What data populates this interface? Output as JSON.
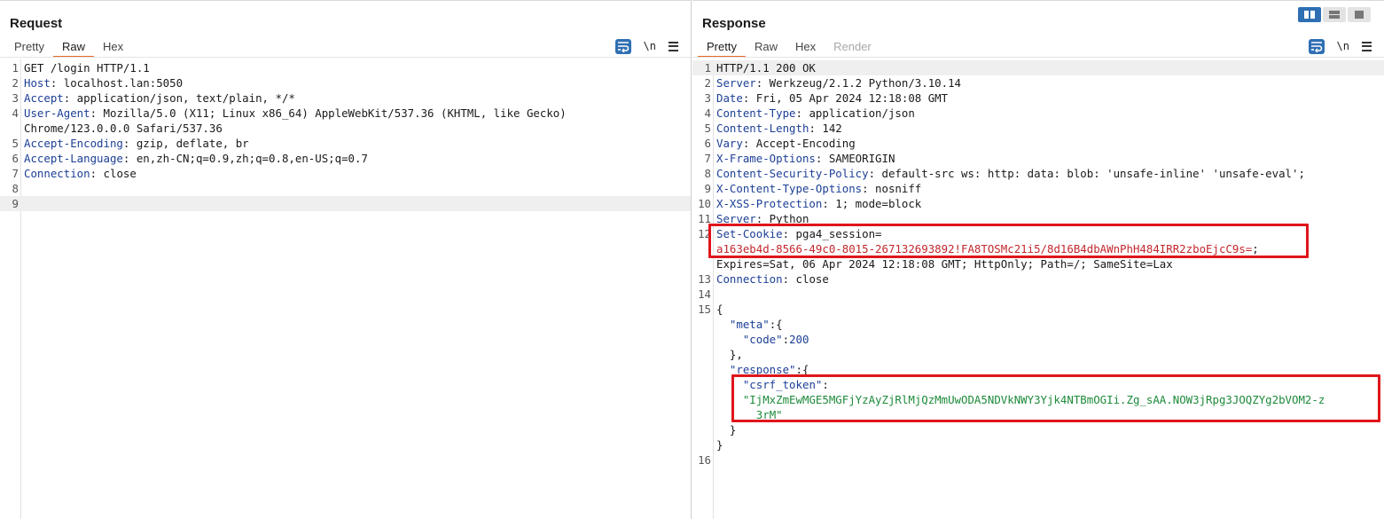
{
  "colors": {
    "accent": "#2f6fb3",
    "tab_underline": "#e8692b",
    "highlight": "#e0151b"
  },
  "request": {
    "title": "Request",
    "tabs": [
      "Pretty",
      "Raw",
      "Hex"
    ],
    "active_tab": "Raw",
    "tools": {
      "wrap_icon": "text-wrap-icon",
      "newline_label": "\\n",
      "menu_icon": "hamburger-menu-icon"
    },
    "lines": [
      {
        "num": "1",
        "name": "",
        "text": "GET /login HTTP/1.1"
      },
      {
        "num": "2",
        "name": "Host",
        "text": ": localhost.lan:5050"
      },
      {
        "num": "3",
        "name": "Accept",
        "text": ": application/json, text/plain, */*"
      },
      {
        "num": "4",
        "name": "User-Agent",
        "text": ": Mozilla/5.0 (X11; Linux x86_64) AppleWebKit/537.36 (KHTML, like Gecko)"
      },
      {
        "num": "",
        "name": "",
        "text": "Chrome/123.0.0.0 Safari/537.36"
      },
      {
        "num": "5",
        "name": "Accept-Encoding",
        "text": ": gzip, deflate, br"
      },
      {
        "num": "6",
        "name": "Accept-Language",
        "text": ": en,zh-CN;q=0.9,zh;q=0.8,en-US;q=0.7"
      },
      {
        "num": "7",
        "name": "Connection",
        "text": ": close"
      },
      {
        "num": "8",
        "name": "",
        "text": ""
      },
      {
        "num": "9",
        "name": "",
        "text": ""
      }
    ]
  },
  "response": {
    "title": "Response",
    "tabs": [
      "Pretty",
      "Raw",
      "Hex",
      "Render"
    ],
    "active_tab": "Pretty",
    "tools": {
      "wrap_icon": "text-wrap-icon",
      "newline_label": "\\n",
      "menu_icon": "hamburger-menu-icon"
    },
    "lines": [
      {
        "num": "1",
        "name": "",
        "text": "HTTP/1.1 200 OK"
      },
      {
        "num": "2",
        "name": "Server",
        "text": ": Werkzeug/2.1.2 Python/3.10.14"
      },
      {
        "num": "3",
        "name": "Date",
        "text": ": Fri, 05 Apr 2024 12:18:08 GMT"
      },
      {
        "num": "4",
        "name": "Content-Type",
        "text": ": application/json"
      },
      {
        "num": "5",
        "name": "Content-Length",
        "text": ": 142"
      },
      {
        "num": "6",
        "name": "Vary",
        "text": ": Accept-Encoding"
      },
      {
        "num": "7",
        "name": "X-Frame-Options",
        "text": ": SAMEORIGIN"
      },
      {
        "num": "8",
        "name": "Content-Security-Policy",
        "text": ": default-src ws: http: data: blob: 'unsafe-inline' 'unsafe-eval';"
      },
      {
        "num": "9",
        "name": "X-Content-Type-Options",
        "text": ": nosniff"
      },
      {
        "num": "10",
        "name": "X-XSS-Protection",
        "text": ": 1; mode=block"
      },
      {
        "num": "11",
        "name": "Server",
        "text": ": Python"
      },
      {
        "num": "12",
        "name": "Set-Cookie",
        "text": ": pga4_session="
      },
      {
        "num": "",
        "name": "",
        "text": "",
        "cookie": "a163eb4d-8566-49c0-8015-267132693892!FA8TOSMc21i5/8d16B4dbAWnPhH484IRR2zboEjcC9s=",
        "tail": ";"
      },
      {
        "num": "",
        "name": "",
        "text": "Expires=Sat, 06 Apr 2024 12:18:08 GMT; HttpOnly; Path=/; SameSite=Lax"
      },
      {
        "num": "13",
        "name": "Connection",
        "text": ": close"
      },
      {
        "num": "14",
        "name": "",
        "text": ""
      },
      {
        "num": "15",
        "name": "",
        "text": "{"
      },
      {
        "num": "",
        "indent": "  ",
        "key": "\"meta\"",
        "text": ":{"
      },
      {
        "num": "",
        "indent": "    ",
        "key": "\"code\"",
        "text": ":",
        "numval": "200"
      },
      {
        "num": "",
        "name": "",
        "text": "  },"
      },
      {
        "num": "",
        "indent": "  ",
        "key": "\"response\"",
        "text": ":{"
      },
      {
        "num": "",
        "indent": "    ",
        "key": "\"csrf_token\"",
        "text": ":"
      },
      {
        "num": "",
        "indent": "    ",
        "str": "\"IjMxZmEwMGE5MGFjYzAyZjRlMjQzMmUwODA5NDVkNWY3Yjk4NTBmOGIi.Zg_sAA.NOW3jRpg3JOQZYg2bVOM2-z"
      },
      {
        "num": "",
        "indent": "     ",
        "str": "_3rM\""
      },
      {
        "num": "",
        "name": "",
        "text": "  }"
      },
      {
        "num": "",
        "name": "",
        "text": "}"
      },
      {
        "num": "16",
        "name": "",
        "text": ""
      }
    ]
  }
}
